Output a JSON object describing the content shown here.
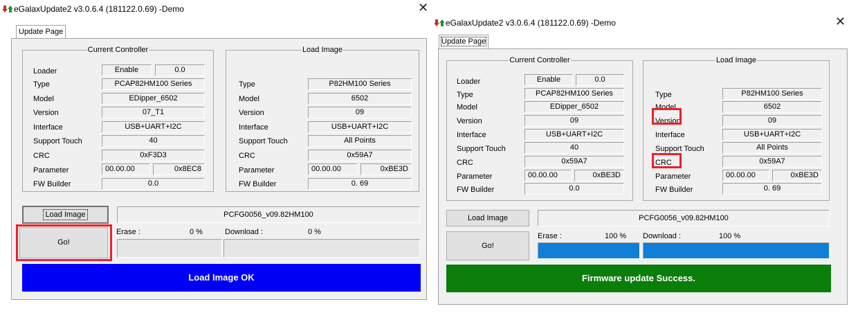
{
  "colors": {
    "highlight_red": "#e8222a",
    "success_green": "#0a7d0a",
    "ok_blue": "#0000f7",
    "progress_blue": "#0f7fd8"
  },
  "left": {
    "title": "eGalaxUpdate2 v3.0.6.4 (181122.0.69) -Demo",
    "close_glyph": "✕",
    "tab_label": "Update Page",
    "current_controller": {
      "legend": "Current Controller",
      "labels": [
        "Loader",
        "Type",
        "Model",
        "Version",
        "Interface",
        "Support Touch",
        "CRC",
        "Parameter",
        "FW Builder"
      ],
      "loader_mode": "Enable",
      "loader_version": "0.0",
      "type": "PCAP82HM100 Series",
      "model": "EDipper_6502",
      "version": "07_T1",
      "interface": "USB+UART+I2C",
      "support_touch": "40",
      "crc": "0xF3D3",
      "parameter_a": "00.00.00",
      "parameter_b": "0x8EC8",
      "fw_builder": "0.0"
    },
    "load_image": {
      "legend": "Load Image",
      "labels": [
        "Type",
        "Model",
        "Version",
        "Interface",
        "Support Touch",
        "CRC",
        "Parameter",
        "FW Builder"
      ],
      "type": "P82HM100 Series",
      "model": "6502",
      "version": "09",
      "interface": "USB+UART+I2C",
      "support_touch": "All Points",
      "crc": "0x59A7",
      "parameter_a": "00.00.00",
      "parameter_b": "0xBE3D",
      "fw_builder": "0. 69"
    },
    "load_image_button": "Load Image",
    "file_name": "PCFG0056_v09.82HM100",
    "go_button": "Go!",
    "erase_label": "Erase :",
    "erase_percent": "0 %",
    "erase_progress": 0,
    "download_label": "Download :",
    "download_percent": "0 %",
    "download_progress": 0,
    "status_text": "Load Image OK"
  },
  "right": {
    "title": "eGalaxUpdate2 v3.0.6.4 (181122.0.69) -Demo",
    "close_glyph": "✕",
    "tab_label": "Update Page",
    "current_controller": {
      "legend": "Current Controller",
      "labels": [
        "Loader",
        "Type",
        "Model",
        "Version",
        "Interface",
        "Support Touch",
        "CRC",
        "Parameter",
        "FW Builder"
      ],
      "loader_mode": "Enable",
      "loader_version": "0.0",
      "type": "PCAP82HM100 Series",
      "model": "EDipper_6502",
      "version": "09",
      "interface": "USB+UART+I2C",
      "support_touch": "40",
      "crc": "0x59A7",
      "parameter_a": "00.00.00",
      "parameter_b": "0xBE3D",
      "fw_builder": "0.0"
    },
    "load_image": {
      "legend": "Load Image",
      "labels": [
        "Type",
        "Model",
        "Version",
        "Interface",
        "Support Touch",
        "CRC",
        "Parameter",
        "FW Builder"
      ],
      "type": "P82HM100 Series",
      "model": "6502",
      "version": "09",
      "interface": "USB+UART+I2C",
      "support_touch": "All Points",
      "crc": "0x59A7",
      "parameter_a": "00.00.00",
      "parameter_b": "0xBE3D",
      "fw_builder": "0. 69"
    },
    "load_image_button": "Load Image",
    "file_name": "PCFG0056_v09.82HM100",
    "go_button": "Go!",
    "erase_label": "Erase :",
    "erase_percent": "100 %",
    "erase_progress": 100,
    "download_label": "Download :",
    "download_percent": "100 %",
    "download_progress": 100,
    "status_text": "Firmware update Success."
  }
}
